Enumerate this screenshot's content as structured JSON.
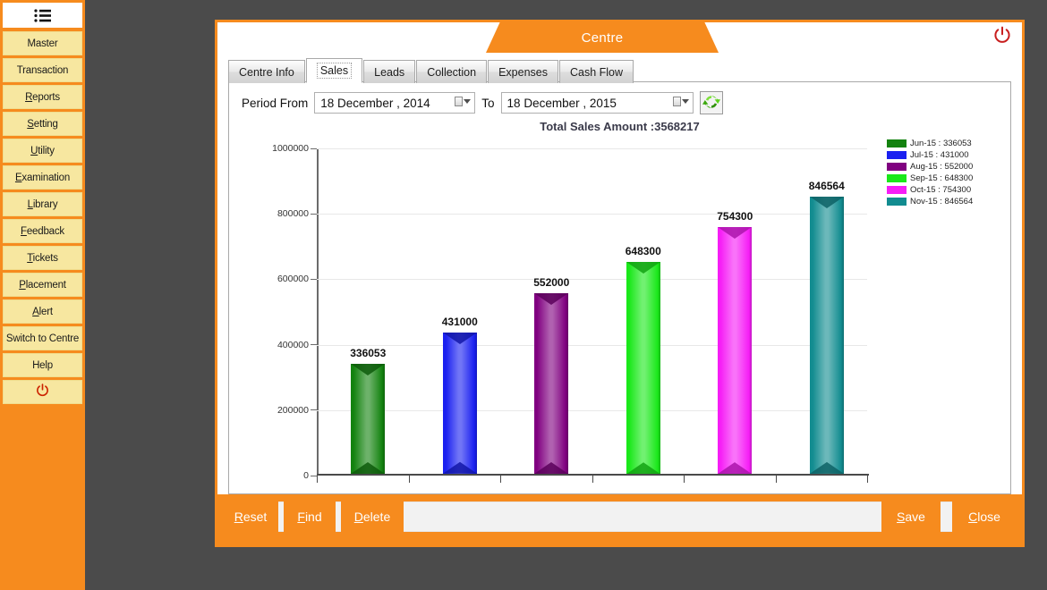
{
  "sidebar": {
    "menu_icon": "hamburger-menu-icon",
    "items": [
      {
        "label": "Master",
        "accel": ""
      },
      {
        "label": "Transaction",
        "accel": ""
      },
      {
        "label": "Reports",
        "accel": "R"
      },
      {
        "label": "Setting",
        "accel": "S"
      },
      {
        "label": "Utility",
        "accel": "U"
      },
      {
        "label": "Examination",
        "accel": "E"
      },
      {
        "label": "Library",
        "accel": "L"
      },
      {
        "label": "Feedback",
        "accel": "F"
      },
      {
        "label": "Tickets",
        "accel": "T"
      },
      {
        "label": "Placement",
        "accel": "P"
      },
      {
        "label": "Alert",
        "accel": "A"
      },
      {
        "label": "Switch to Centre",
        "accel": ""
      },
      {
        "label": "Help",
        "accel": ""
      }
    ],
    "power_icon": "power-icon"
  },
  "window": {
    "title": "Centre",
    "close_icon": "power-icon"
  },
  "tabs": [
    {
      "label": "Centre Info",
      "active": false
    },
    {
      "label": "Sales",
      "active": true
    },
    {
      "label": "Leads",
      "active": false
    },
    {
      "label": "Collection",
      "active": false
    },
    {
      "label": "Expenses",
      "active": false
    },
    {
      "label": "Cash Flow",
      "active": false
    }
  ],
  "filters": {
    "period_from_label": "Period From",
    "period_from_value": "18 December , 2014",
    "to_label": "To",
    "period_to_value": "18 December , 2015",
    "refresh_icon": "refresh-icon"
  },
  "chart_data": {
    "type": "bar",
    "title": "Total Sales Amount :3568217",
    "xlabel": "",
    "ylabel": "",
    "ylim": [
      0,
      1000000
    ],
    "yticks": [
      "0",
      "200000",
      "400000",
      "600000",
      "800000",
      "1000000"
    ],
    "ytick_values": [
      0,
      200000,
      400000,
      600000,
      800000,
      1000000
    ],
    "grid": true,
    "legend_position": "right",
    "categories": [
      "Jun-15",
      "Jul-15",
      "Aug-15",
      "Sep-15",
      "Oct-15",
      "Nov-15"
    ],
    "values": [
      336053,
      431000,
      552000,
      648300,
      754300,
      846564
    ],
    "data_labels": [
      "336053",
      "431000",
      "552000",
      "648300",
      "754300",
      "846564"
    ],
    "colors": [
      "#13820f",
      "#1a20f0",
      "#800080",
      "#1ae81a",
      "#f61df6",
      "#128c90"
    ],
    "legend": [
      {
        "label": "Jun-15 : 336053",
        "color": "#13820f"
      },
      {
        "label": "Jul-15 : 431000",
        "color": "#1a20f0"
      },
      {
        "label": "Aug-15 : 552000",
        "color": "#800080"
      },
      {
        "label": "Sep-15 : 648300",
        "color": "#1ae81a"
      },
      {
        "label": "Oct-15 : 754300",
        "color": "#f61df6"
      },
      {
        "label": "Nov-15 : 846564",
        "color": "#128c90"
      }
    ]
  },
  "footer": {
    "reset_label": "Reset",
    "find_label": "Find",
    "delete_label": "Delete",
    "save_label": "Save",
    "close_label": "Close"
  },
  "theme": {
    "accent": "#f68b1e",
    "sidebar_item_bg": "#f7e7a0",
    "desktop_bg": "#4b4b4b"
  }
}
